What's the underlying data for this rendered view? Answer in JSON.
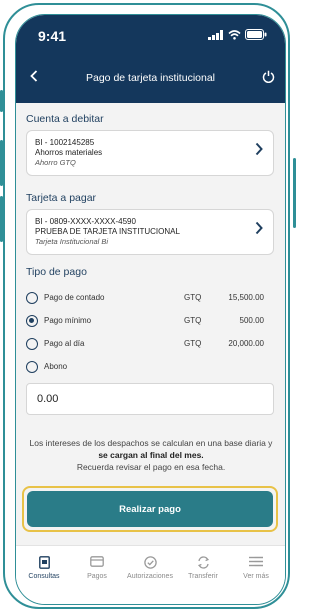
{
  "status_bar": {
    "time": "9:41"
  },
  "header": {
    "title": "Pago de tarjeta institucional",
    "back_icon": "chevron-left-icon",
    "power_icon": "power-icon"
  },
  "debit_section": {
    "label": "Cuenta a debitar",
    "account_line1": "BI - 1002145285",
    "account_line2": "Ahorros materiales",
    "account_line3": "Ahorro GTQ"
  },
  "card_section": {
    "label": "Tarjeta a pagar",
    "card_line1": "BI - 0809-XXXX-XXXX-4590",
    "card_line2": "PRUEBA DE TARJETA INSTITUCIONAL",
    "card_line3": "Tarjeta Institucional Bi"
  },
  "payment_type": {
    "label": "Tipo de pago",
    "options": [
      {
        "label": "Pago de contado",
        "currency": "GTQ",
        "amount": "15,500.00",
        "selected": false
      },
      {
        "label": "Pago mínimo",
        "currency": "GTQ",
        "amount": "500.00",
        "selected": true
      },
      {
        "label": "Pago al día",
        "currency": "GTQ",
        "amount": "20,000.00",
        "selected": false
      },
      {
        "label": "Abono",
        "currency": "",
        "amount": "",
        "selected": false
      }
    ]
  },
  "amount_input": {
    "value": "0.00"
  },
  "note": {
    "part1": "Los intereses de los despachos se calculan en una base diaria y ",
    "part2": "se cargan al final del mes.",
    "part3": "Recuerda revisar el pago en esa fecha."
  },
  "pay_button": {
    "label": "Realizar pago"
  },
  "tabbar": {
    "items": [
      {
        "label": "Consultas",
        "icon": "document-icon",
        "active": true
      },
      {
        "label": "Pagos",
        "icon": "card-icon",
        "active": false
      },
      {
        "label": "Autorizaciones",
        "icon": "check-circle-icon",
        "active": false
      },
      {
        "label": "Transferir",
        "icon": "transfer-icon",
        "active": false
      },
      {
        "label": "Ver más",
        "icon": "menu-icon",
        "active": false
      }
    ]
  },
  "colors": {
    "header": "#14375c",
    "accent": "#2a7c88",
    "highlight": "#e8c247",
    "frame": "#2f8f97"
  }
}
